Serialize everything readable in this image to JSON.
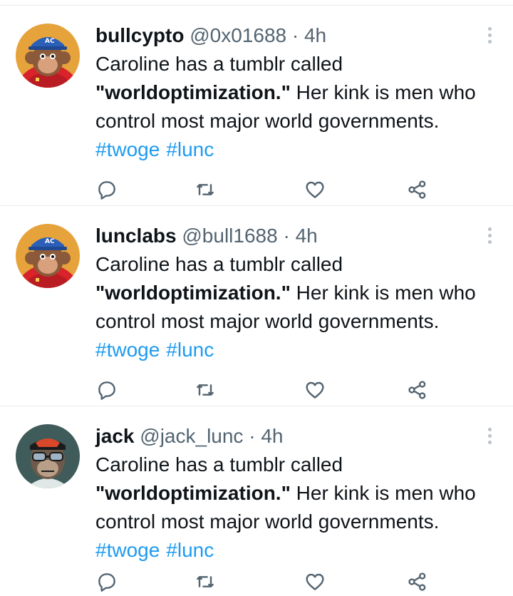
{
  "tweets": [
    {
      "name": "bullcypto",
      "handle": "@0x01688",
      "separator": "·",
      "time": "4h",
      "avatar": "monkey-avatar-red-hoodie",
      "text_line1": "Caroline has a tumblr called",
      "text_line2_bold": "\"worldoptimization.\"",
      "text_line2_rest": " Her kink is men who",
      "text_line3": "control most major world governments.",
      "hashtags": [
        "#twoge",
        "#lunc"
      ]
    },
    {
      "name": "lunclabs",
      "handle": "@bull1688",
      "separator": "·",
      "time": "4h",
      "avatar": "monkey-avatar-red-hoodie",
      "text_line1": "Caroline has a tumblr called",
      "text_line2_bold": "\"worldoptimization.\"",
      "text_line2_rest": " Her kink is men who",
      "text_line3": "control most major world governments.",
      "hashtags": [
        "#twoge",
        "#lunc"
      ]
    },
    {
      "name": "jack",
      "handle": "@jack_lunc",
      "separator": "·",
      "time": "4h",
      "avatar": "ape-avatar-goggles",
      "text_line1": "Caroline has a tumblr called",
      "text_line2_bold": "\"worldoptimization.\"",
      "text_line2_rest": " Her kink is men who",
      "text_line3": "control most major world governments.",
      "hashtags": [
        "#twoge",
        "#lunc"
      ]
    }
  ],
  "icons": {
    "reply": "reply-icon",
    "retweet": "retweet-icon",
    "like": "heart-icon",
    "share": "share-icon",
    "more": "more-vertical-icon"
  },
  "colors": {
    "link": "#1d9bf0",
    "secondary_text": "#536471",
    "divider": "#e6ecf0",
    "more_icon": "#b8c2cc"
  }
}
